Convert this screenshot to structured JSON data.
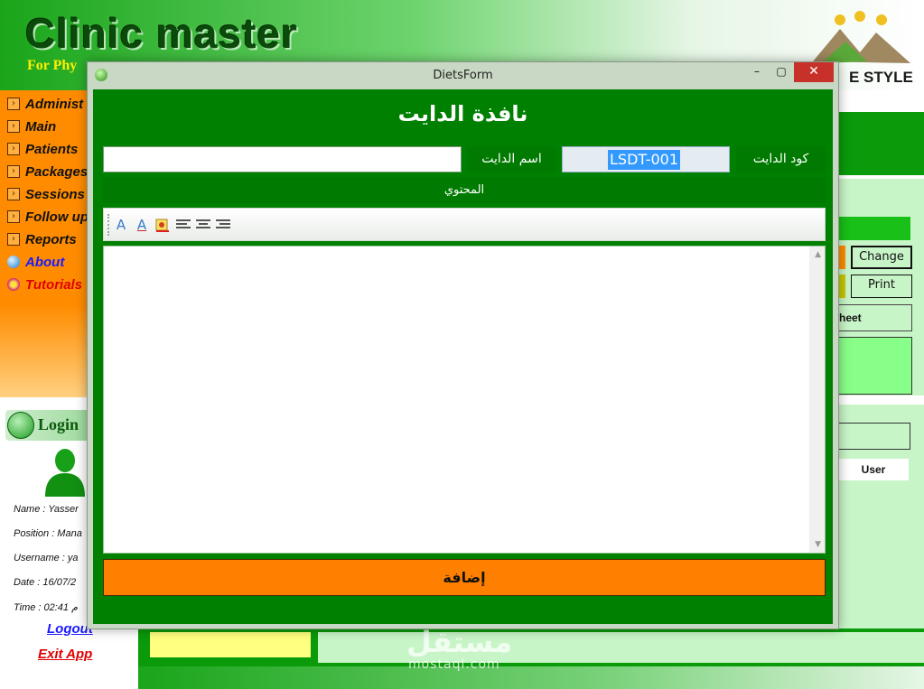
{
  "app": {
    "title": "Clinic master",
    "subtitle": "For Phy",
    "brand": "E STYLE",
    "window_close": "✕"
  },
  "sidebar": {
    "items": [
      {
        "label": "Administ",
        "icon": "arrow-box-icon"
      },
      {
        "label": "Main",
        "icon": "arrow-box-icon"
      },
      {
        "label": "Patients",
        "icon": "arrow-box-icon"
      },
      {
        "label": "Packages",
        "icon": "arrow-box-icon"
      },
      {
        "label": "Sessions",
        "icon": "arrow-box-icon"
      },
      {
        "label": "Follow up",
        "icon": "arrow-box-icon"
      },
      {
        "label": "Reports",
        "icon": "arrow-box-icon"
      },
      {
        "label": "About",
        "icon": "globe-icon"
      },
      {
        "label": "Tutorials",
        "icon": "star-icon"
      }
    ],
    "arrow_glyph": "›"
  },
  "login": {
    "title": "Login",
    "name": "Name : Yasser",
    "position": "Position : Mana",
    "username": "Username : ya",
    "date": "Date : 16/07/2",
    "time": "Time : 02:41 م",
    "logout": "Logout",
    "exit": "Exit App"
  },
  "background": {
    "change_label": "Change",
    "print_label": "Print",
    "sheet_label": "heet",
    "user_col": "User",
    "watermark": "مستقل",
    "watermark_sub": "mostaql.com"
  },
  "dialog": {
    "title": "DietsForm",
    "minimize": "–",
    "maximize": "▢",
    "close": "✕",
    "heading": "نافذة الدايت",
    "diet_name_label": "اسم الدايت",
    "diet_name_value": "",
    "diet_code_label": "كود الدايت",
    "diet_code_value": "LSDT-001",
    "content_label": "المحتوي",
    "add_button": "إضافة",
    "toolbar": {
      "font_glyph": "A",
      "color_glyph": "A",
      "icons": [
        "font-icon",
        "font-color-icon",
        "highlight-icon",
        "align-left-icon",
        "align-center-icon",
        "align-right-icon"
      ]
    },
    "scroll_up": "▲",
    "scroll_down": "▼"
  },
  "colors": {
    "dialog_green": "#008000",
    "label_green": "#007a00",
    "add_orange": "#ff8000",
    "sidebar_orange": "#ff8c00",
    "selection_blue": "#3399ff"
  }
}
